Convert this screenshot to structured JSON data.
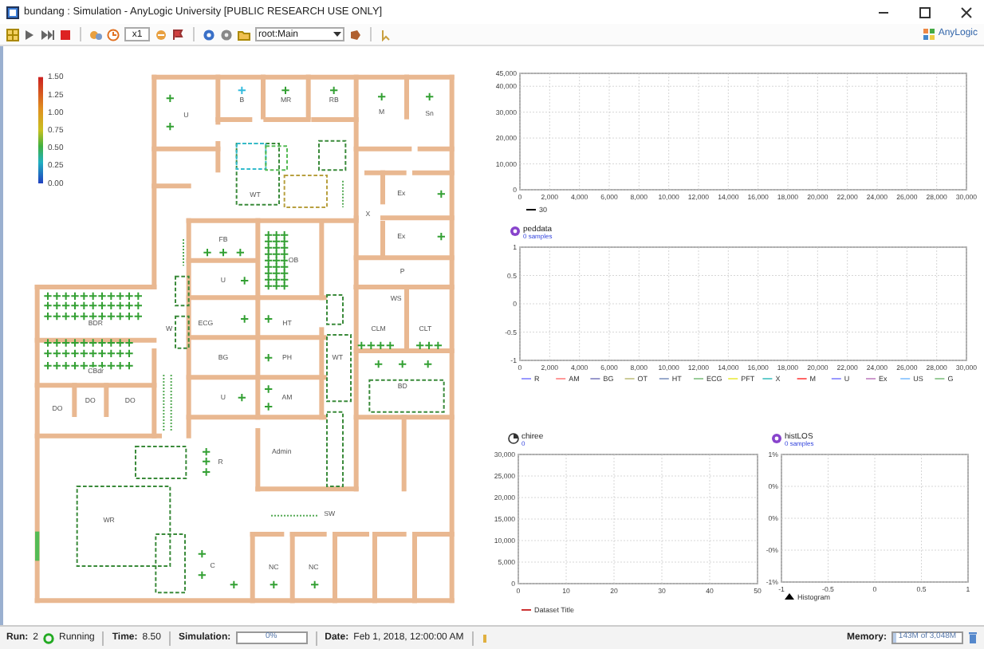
{
  "window": {
    "title": "bundang : Simulation - AnyLogic University  [PUBLIC RESEARCH USE ONLY]"
  },
  "toolbar": {
    "speed": "x1",
    "root": "root:Main",
    "logo": "AnyLogic"
  },
  "legend": {
    "labels": [
      "1.50",
      "1.25",
      "1.00",
      "0.75",
      "0.50",
      "0.25",
      "0.00"
    ]
  },
  "floor_plan": {
    "rooms": [
      {
        "label": "U"
      },
      {
        "label": "B"
      },
      {
        "label": "MR"
      },
      {
        "label": "RB"
      },
      {
        "label": "M"
      },
      {
        "label": "Sn"
      },
      {
        "label": "WT"
      },
      {
        "label": "X"
      },
      {
        "label": "Ex"
      },
      {
        "label": "Ex"
      },
      {
        "label": "P"
      },
      {
        "label": "FB"
      },
      {
        "label": "OB"
      },
      {
        "label": "U"
      },
      {
        "label": "WS"
      },
      {
        "label": "BDR"
      },
      {
        "label": "ECG"
      },
      {
        "label": "HT"
      },
      {
        "label": "W"
      },
      {
        "label": "CLM"
      },
      {
        "label": "CLT"
      },
      {
        "label": "BG"
      },
      {
        "label": "PH"
      },
      {
        "label": "WT"
      },
      {
        "label": "CBdr"
      },
      {
        "label": "BD"
      },
      {
        "label": "U"
      },
      {
        "label": "AM"
      },
      {
        "label": "DO"
      },
      {
        "label": "DO"
      },
      {
        "label": "DO"
      },
      {
        "label": "R"
      },
      {
        "label": "Admin"
      },
      {
        "label": "WR"
      },
      {
        "label": "SW"
      },
      {
        "label": "C"
      },
      {
        "label": "NC"
      },
      {
        "label": "NC"
      }
    ]
  },
  "charts": [
    {
      "chart_data": {
        "type": "line",
        "grid": true,
        "ylim": [
          0,
          45000
        ],
        "categories": [
          "0",
          "2,000",
          "4,000",
          "6,000",
          "8,000",
          "10,000",
          "12,000",
          "14,000",
          "16,000",
          "18,000",
          "20,000",
          "22,000",
          "24,000",
          "26,000",
          "28,000",
          "30,000"
        ],
        "yticks": [
          {
            "value": 0,
            "label": "0"
          },
          {
            "value": 10000,
            "label": "10,000"
          },
          {
            "value": 20000,
            "label": "20,000"
          },
          {
            "value": 30000,
            "label": "30,000"
          },
          {
            "value": 40000,
            "label": "40,000"
          },
          {
            "value": 45000,
            "label": "45,000"
          }
        ],
        "series": [
          {
            "name": "30",
            "color": "#000000",
            "values": [
              null,
              null,
              null,
              null,
              null,
              null,
              null,
              null,
              null,
              null,
              null,
              null,
              null,
              null,
              null,
              null
            ]
          }
        ]
      }
    },
    {
      "kind": "statistics",
      "caption": "0 samples",
      "chart_data": {
        "type": "line",
        "title": "peddata",
        "grid": true,
        "ylim": [
          -1,
          1
        ],
        "categories": [
          "0",
          "2,000",
          "4,000",
          "6,000",
          "8,000",
          "10,000",
          "12,000",
          "14,000",
          "16,000",
          "18,000",
          "20,000",
          "22,000",
          "24,000",
          "26,000",
          "28,000",
          "30,000"
        ],
        "yticks": [
          {
            "value": -1,
            "label": "-1"
          },
          {
            "value": -0.5,
            "label": "-0.5"
          },
          {
            "value": 0,
            "label": "0"
          },
          {
            "value": 0.5,
            "label": "0.5"
          },
          {
            "value": 1,
            "label": "1"
          }
        ],
        "series": [
          {
            "name": "R",
            "color": "#9999ff",
            "values": [
              null,
              null,
              null,
              null,
              null,
              null,
              null,
              null,
              null,
              null,
              null,
              null,
              null,
              null,
              null,
              null
            ]
          },
          {
            "name": "AM",
            "color": "#ff9999",
            "values": [
              null,
              null,
              null,
              null,
              null,
              null,
              null,
              null,
              null,
              null,
              null,
              null,
              null,
              null,
              null,
              null
            ]
          },
          {
            "name": "BG",
            "color": "#9999cc",
            "values": [
              null,
              null,
              null,
              null,
              null,
              null,
              null,
              null,
              null,
              null,
              null,
              null,
              null,
              null,
              null,
              null
            ]
          },
          {
            "name": "OT",
            "color": "#cccc99",
            "values": [
              null,
              null,
              null,
              null,
              null,
              null,
              null,
              null,
              null,
              null,
              null,
              null,
              null,
              null,
              null,
              null
            ]
          },
          {
            "name": "HT",
            "color": "#99aacc",
            "values": [
              null,
              null,
              null,
              null,
              null,
              null,
              null,
              null,
              null,
              null,
              null,
              null,
              null,
              null,
              null,
              null
            ]
          },
          {
            "name": "ECG",
            "color": "#99cc99",
            "values": [
              null,
              null,
              null,
              null,
              null,
              null,
              null,
              null,
              null,
              null,
              null,
              null,
              null,
              null,
              null,
              null
            ]
          },
          {
            "name": "PFT",
            "color": "#eeee66",
            "values": [
              null,
              null,
              null,
              null,
              null,
              null,
              null,
              null,
              null,
              null,
              null,
              null,
              null,
              null,
              null,
              null
            ]
          },
          {
            "name": "X",
            "color": "#66cccc",
            "values": [
              null,
              null,
              null,
              null,
              null,
              null,
              null,
              null,
              null,
              null,
              null,
              null,
              null,
              null,
              null,
              null
            ]
          },
          {
            "name": "M",
            "color": "#ff6666",
            "values": [
              null,
              null,
              null,
              null,
              null,
              null,
              null,
              null,
              null,
              null,
              null,
              null,
              null,
              null,
              null,
              null
            ]
          },
          {
            "name": "U",
            "color": "#9999ff",
            "values": [
              null,
              null,
              null,
              null,
              null,
              null,
              null,
              null,
              null,
              null,
              null,
              null,
              null,
              null,
              null,
              null
            ]
          },
          {
            "name": "Ex",
            "color": "#cc99cc",
            "values": [
              null,
              null,
              null,
              null,
              null,
              null,
              null,
              null,
              null,
              null,
              null,
              null,
              null,
              null,
              null,
              null
            ]
          },
          {
            "name": "US",
            "color": "#99ccff",
            "values": [
              null,
              null,
              null,
              null,
              null,
              null,
              null,
              null,
              null,
              null,
              null,
              null,
              null,
              null,
              null,
              null
            ]
          },
          {
            "name": "G",
            "color": "#99cc99",
            "values": [
              null,
              null,
              null,
              null,
              null,
              null,
              null,
              null,
              null,
              null,
              null,
              null,
              null,
              null,
              null,
              null
            ]
          }
        ]
      }
    },
    {
      "kind": "dataset",
      "caption": "0",
      "chart_data": {
        "type": "line",
        "title": "chiree",
        "grid": true,
        "ylim": [
          0,
          30000
        ],
        "categories": [
          "0",
          "10",
          "20",
          "30",
          "40",
          "50"
        ],
        "yticks": [
          {
            "value": 0,
            "label": "0"
          },
          {
            "value": 5000,
            "label": "5,000"
          },
          {
            "value": 10000,
            "label": "10,000"
          },
          {
            "value": 15000,
            "label": "15,000"
          },
          {
            "value": 20000,
            "label": "20,000"
          },
          {
            "value": 25000,
            "label": "25,000"
          },
          {
            "value": 30000,
            "label": "30,000"
          }
        ],
        "series": [
          {
            "name": "Dataset Title",
            "color": "#cc3333",
            "values": [
              null,
              null,
              null,
              null,
              null,
              null
            ]
          }
        ]
      }
    },
    {
      "kind": "statistics",
      "caption": "0 samples",
      "chart_data": {
        "type": "bar",
        "title": "histLOS",
        "grid": true,
        "ylim": [
          -1,
          1
        ],
        "categories": [
          "-1",
          "-0.5",
          "0",
          "0.5",
          "1"
        ],
        "yticks": [
          {
            "value": -1,
            "label": "-1%"
          },
          {
            "value": -0.5,
            "label": "-0%"
          },
          {
            "value": 0,
            "label": "0%"
          },
          {
            "value": 0.5,
            "label": "0%"
          },
          {
            "value": 1,
            "label": "1%"
          }
        ],
        "series": [
          {
            "name": "Histogram",
            "color": "#000000",
            "values": [
              null,
              null,
              null,
              null,
              null
            ]
          }
        ]
      }
    }
  ],
  "status_bar": {
    "run": {
      "label": "Run:",
      "value": "2",
      "state": "Running"
    },
    "time": {
      "label": "Time:",
      "value": "8.50"
    },
    "simulation": {
      "label": "Simulation:",
      "text": "0%",
      "level": 0
    },
    "date": {
      "label": "Date:",
      "value": "Feb 1, 2018, 12:00:00 AM"
    },
    "memory": {
      "label": "Memory:",
      "text": "143M of 3,048M",
      "level": 0.05
    }
  }
}
